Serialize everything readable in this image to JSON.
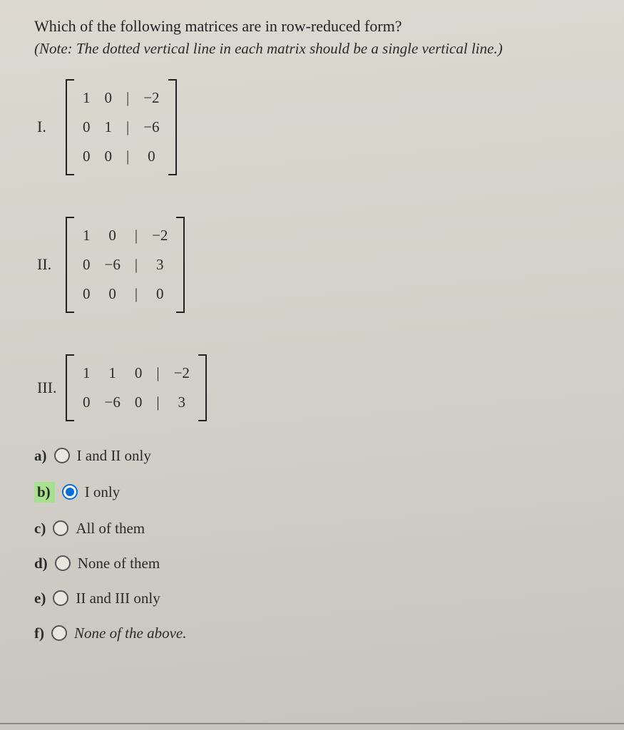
{
  "question": "Which of the following matrices are in row-reduced form?",
  "note": "(Note: The dotted vertical line in each matrix should be a single vertical line.)",
  "matrices": {
    "m1": {
      "label": "I.",
      "rows": [
        [
          "1",
          "0",
          "|",
          "−2"
        ],
        [
          "0",
          "1",
          "|",
          "−6"
        ],
        [
          "0",
          "0",
          "|",
          "0"
        ]
      ]
    },
    "m2": {
      "label": "II.",
      "rows": [
        [
          "1",
          "0",
          "|",
          "−2"
        ],
        [
          "0",
          "−6",
          "|",
          "3"
        ],
        [
          "0",
          "0",
          "|",
          "0"
        ]
      ]
    },
    "m3": {
      "label": "III.",
      "rows": [
        [
          "1",
          "1",
          "0",
          "|",
          "−2"
        ],
        [
          "0",
          "−6",
          "0",
          "|",
          "3"
        ]
      ]
    }
  },
  "options": {
    "a": {
      "letter": "a)",
      "label": "I and II only",
      "italic": false
    },
    "b": {
      "letter": "b)",
      "label": "I only",
      "italic": false
    },
    "c": {
      "letter": "c)",
      "label": "All of them",
      "italic": false
    },
    "d": {
      "letter": "d)",
      "label": "None of them",
      "italic": false
    },
    "e": {
      "letter": "e)",
      "label": "II and III only",
      "italic": false
    },
    "f": {
      "letter": "f)",
      "label": "None of the above.",
      "italic": true
    }
  },
  "selected": "b"
}
